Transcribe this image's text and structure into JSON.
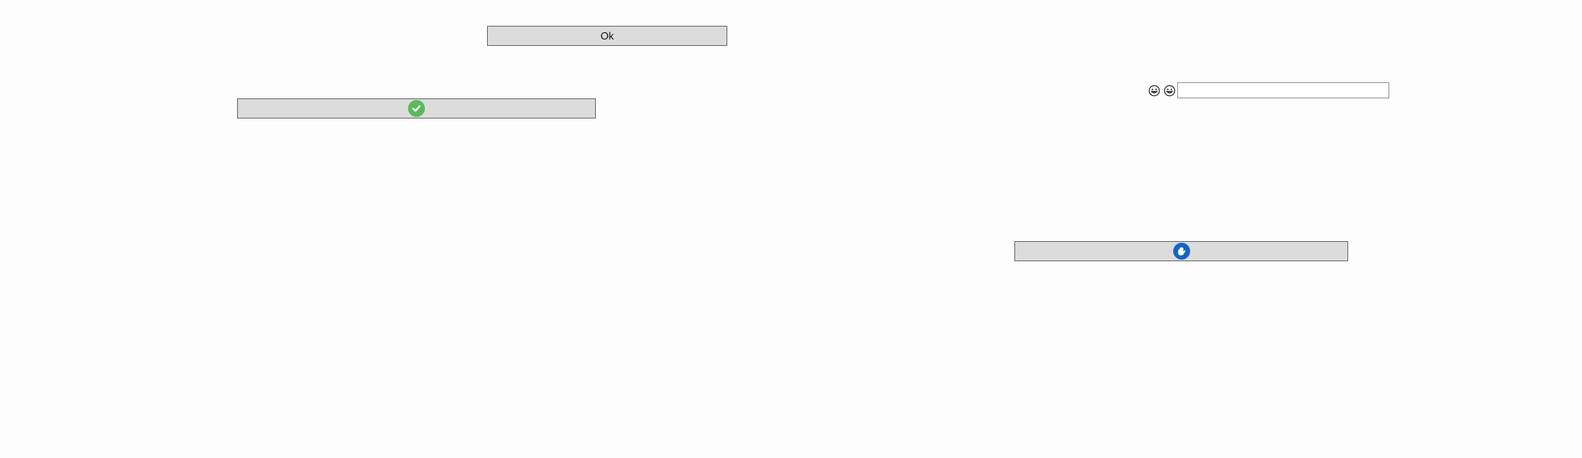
{
  "buttons": {
    "ok_label": "Ok",
    "confirm_icon": "check-circle-icon",
    "hand_icon": "raised-hand-icon"
  },
  "input": {
    "value": "",
    "placeholder": ""
  },
  "emoji_icons": [
    "grinning-face-icon",
    "grinning-face-icon"
  ],
  "colors": {
    "button_bg": "#dcdcdc",
    "check_green": "#5cb85c",
    "hand_blue": "#1565c0"
  }
}
